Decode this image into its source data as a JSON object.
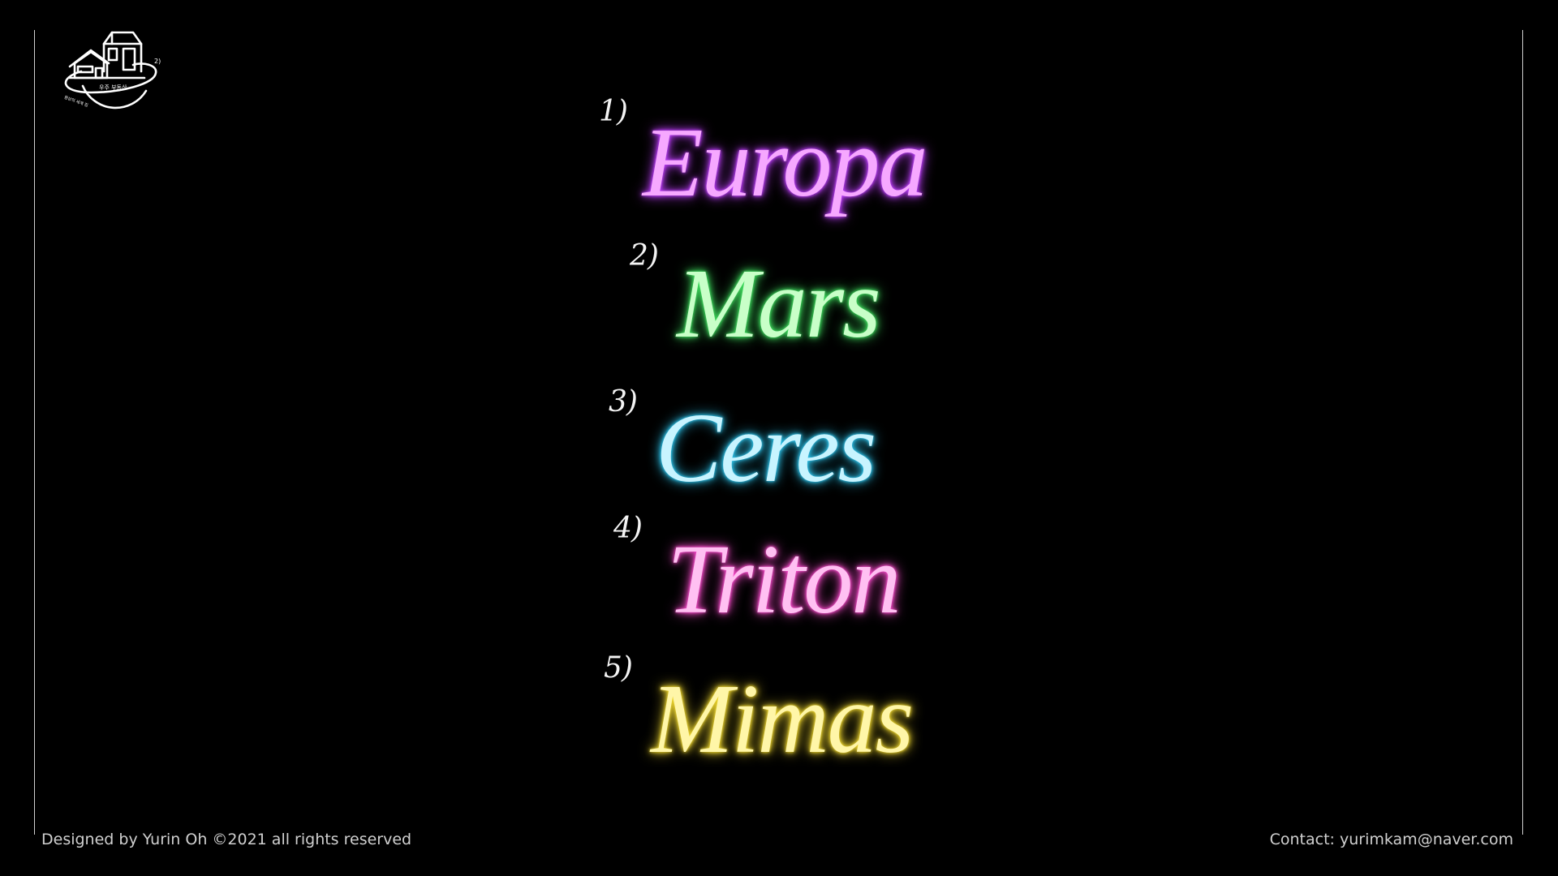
{
  "logo": {
    "icon": "house-planet-logo-icon",
    "title_text": "우주 부동산",
    "subtitle_text": "환상의 세계 집"
  },
  "planets": [
    {
      "number": "1)",
      "name": "Europa",
      "color": "#f6a8ff",
      "glow": "#c040ff"
    },
    {
      "number": "2)",
      "name": "Mars",
      "color": "#c8ffc8",
      "glow": "#40e060"
    },
    {
      "number": "3)",
      "name": "Ceres",
      "color": "#c8f4ff",
      "glow": "#30c8f0"
    },
    {
      "number": "4)",
      "name": "Triton",
      "color": "#ffc0f2",
      "glow": "#ff4ed0"
    },
    {
      "number": "5)",
      "name": "Mimas",
      "color": "#fff6a8",
      "glow": "#f0d830"
    }
  ],
  "footer": {
    "credit": "Designed by Yurin Oh ©2021 all rights reserved",
    "contact": "Contact: yurimkam@naver.com"
  },
  "colors": {
    "background": "#000000",
    "frame_line": "#cfcfcf",
    "footer_text": "#d0d0d0"
  }
}
